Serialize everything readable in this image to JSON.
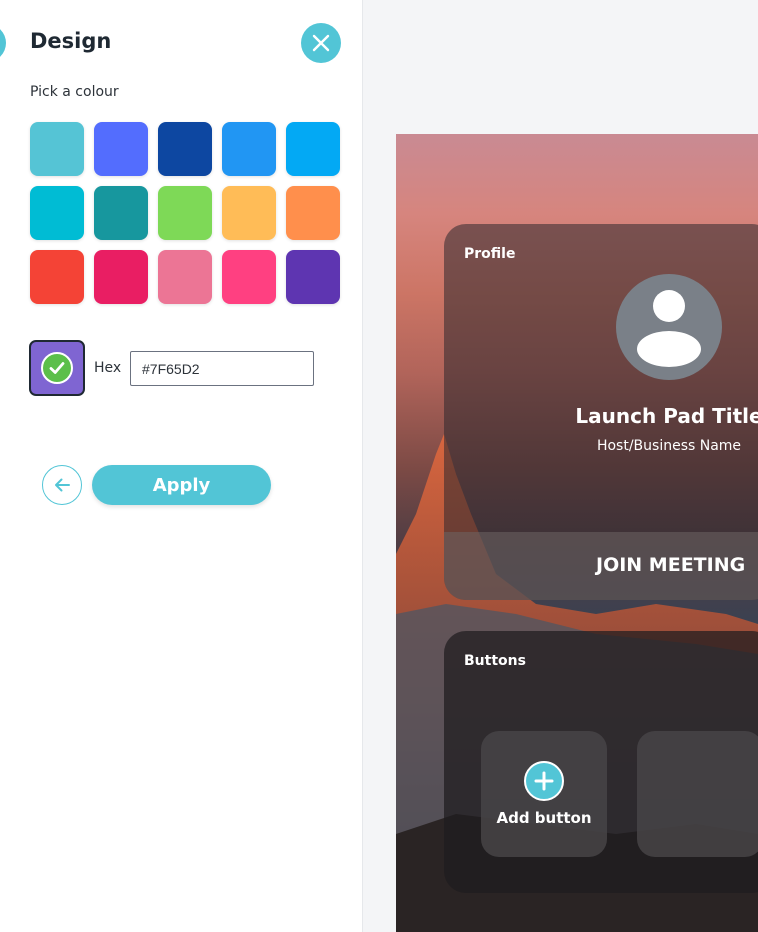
{
  "panel": {
    "title": "Design",
    "subtitle": "Pick a colour",
    "swatches": [
      "#55C4D5",
      "#536DFE",
      "#0D47A1",
      "#2196F3",
      "#03A9F4",
      "#00BCD4",
      "#17979E",
      "#7ED957",
      "#FFBC57",
      "#FF8F4C",
      "#F44336",
      "#E91E63",
      "#EC7595",
      "#FF4081",
      "#5E35B1"
    ],
    "current_color": "#7F65D2",
    "hex_label": "Hex",
    "hex_value": "#7F65D2",
    "apply_label": "Apply"
  },
  "preview": {
    "profile_label": "Profile",
    "title": "Launch Pad Title",
    "subtitle": "Host/Business Name",
    "join_label": "JOIN MEETING",
    "buttons_label": "Buttons",
    "add_button_label": "Add button"
  },
  "colors": {
    "accent": "#52C5D6",
    "check": "#5CBF4A"
  },
  "icons": {
    "close": "close-icon",
    "check": "check-icon",
    "back": "arrow-left-icon",
    "avatar": "user-icon",
    "plus": "plus-icon"
  }
}
